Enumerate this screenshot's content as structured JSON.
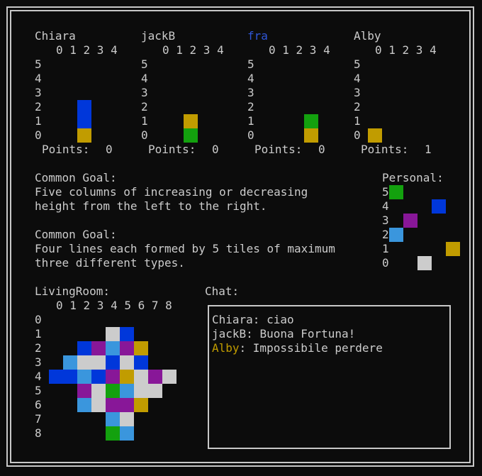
{
  "colors": {
    "background": "#0c0c0c",
    "text": "#cccccc",
    "border": "#c8c8c8",
    "tile_blue": "#0037da",
    "tile_green": "#13a10e",
    "tile_gold": "#c19c00",
    "tile_purple": "#881798",
    "tile_lightblue": "#3a96dd",
    "tile_white": "#cccccc",
    "name_blue": "#2f56d8",
    "name_gold": "#c19c00"
  },
  "players": [
    {
      "name": "Chiara",
      "points_label": "Points:",
      "points": "0",
      "shelf": [
        {
          "col": 2,
          "row": 0,
          "color": "gold"
        },
        {
          "col": 2,
          "row": 1,
          "color": "blue"
        },
        {
          "col": 2,
          "row": 2,
          "color": "blue"
        }
      ]
    },
    {
      "name": "jackB",
      "points_label": "Points:",
      "points": "0",
      "shelf": [
        {
          "col": 2,
          "row": 0,
          "color": "green"
        },
        {
          "col": 2,
          "row": 1,
          "color": "gold"
        }
      ]
    },
    {
      "name": "fra",
      "points_label": "Points:",
      "points": "0",
      "shelf": [
        {
          "col": 3,
          "row": 0,
          "color": "gold"
        },
        {
          "col": 3,
          "row": 1,
          "color": "green"
        }
      ]
    },
    {
      "name": "Alby",
      "points_label": "Points:",
      "points": "1",
      "shelf": [
        {
          "col": 0,
          "row": 0,
          "color": "gold"
        }
      ]
    }
  ],
  "shelf_col_header": "0 1 2 3 4",
  "shelf_rows": [
    "5",
    "4",
    "3",
    "2",
    "1",
    "0"
  ],
  "common_goals": [
    {
      "title": "Common Goal:",
      "line1": "Five columns of increasing or decreasing",
      "line2": "height from the left to the right."
    },
    {
      "title": "Common Goal:",
      "line1": "Four lines each formed by 5 tiles of maximum",
      "line2": "three different types."
    }
  ],
  "personal": {
    "title": "Personal:",
    "rows": [
      "5",
      "4",
      "3",
      "2",
      "1",
      "0"
    ],
    "tiles": [
      {
        "row": 5,
        "col": 0,
        "color": "green"
      },
      {
        "row": 4,
        "col": 3,
        "color": "blue"
      },
      {
        "row": 3,
        "col": 1,
        "color": "purple"
      },
      {
        "row": 2,
        "col": 0,
        "color": "lightblue"
      },
      {
        "row": 1,
        "col": 4,
        "color": "gold"
      },
      {
        "row": 0,
        "col": 2,
        "color": "white"
      }
    ]
  },
  "living_room": {
    "title": "LivingRoom:",
    "col_header": "0 1 2 3 4 5 6 7 8",
    "rows": [
      "0",
      "1",
      "2",
      "3",
      "4",
      "5",
      "6",
      "7",
      "8"
    ],
    "grid": [
      [
        null,
        null,
        null,
        null,
        null,
        null,
        null,
        null,
        null
      ],
      [
        null,
        null,
        null,
        null,
        "white",
        "blue",
        null,
        null,
        null
      ],
      [
        null,
        null,
        "blue",
        "purple",
        "lightblue",
        "purple",
        "gold",
        null,
        null
      ],
      [
        null,
        "lightblue",
        "white",
        "white",
        "blue",
        "white",
        "blue",
        null,
        null
      ],
      [
        "blue",
        "blue",
        "lightblue",
        "blue",
        "purple",
        "gold",
        "white",
        "purple",
        "white"
      ],
      [
        null,
        null,
        "purple",
        "white",
        "green",
        "lightblue",
        "white",
        "white",
        null
      ],
      [
        null,
        null,
        "lightblue",
        "white",
        "purple",
        "purple",
        "gold",
        null,
        null
      ],
      [
        null,
        null,
        null,
        null,
        "lightblue",
        "white",
        null,
        null,
        null
      ],
      [
        null,
        null,
        null,
        null,
        "green",
        "lightblue",
        null,
        null,
        null
      ]
    ]
  },
  "chat": {
    "title": "Chat:",
    "messages": [
      {
        "sender": "Chiara",
        "text": ": ciao",
        "color": "text"
      },
      {
        "sender": "jackB",
        "text": ": Buona Fortuna!",
        "color": "text"
      },
      {
        "sender": "Alby",
        "text": ": Impossibile perdere",
        "color": "gold"
      }
    ]
  }
}
